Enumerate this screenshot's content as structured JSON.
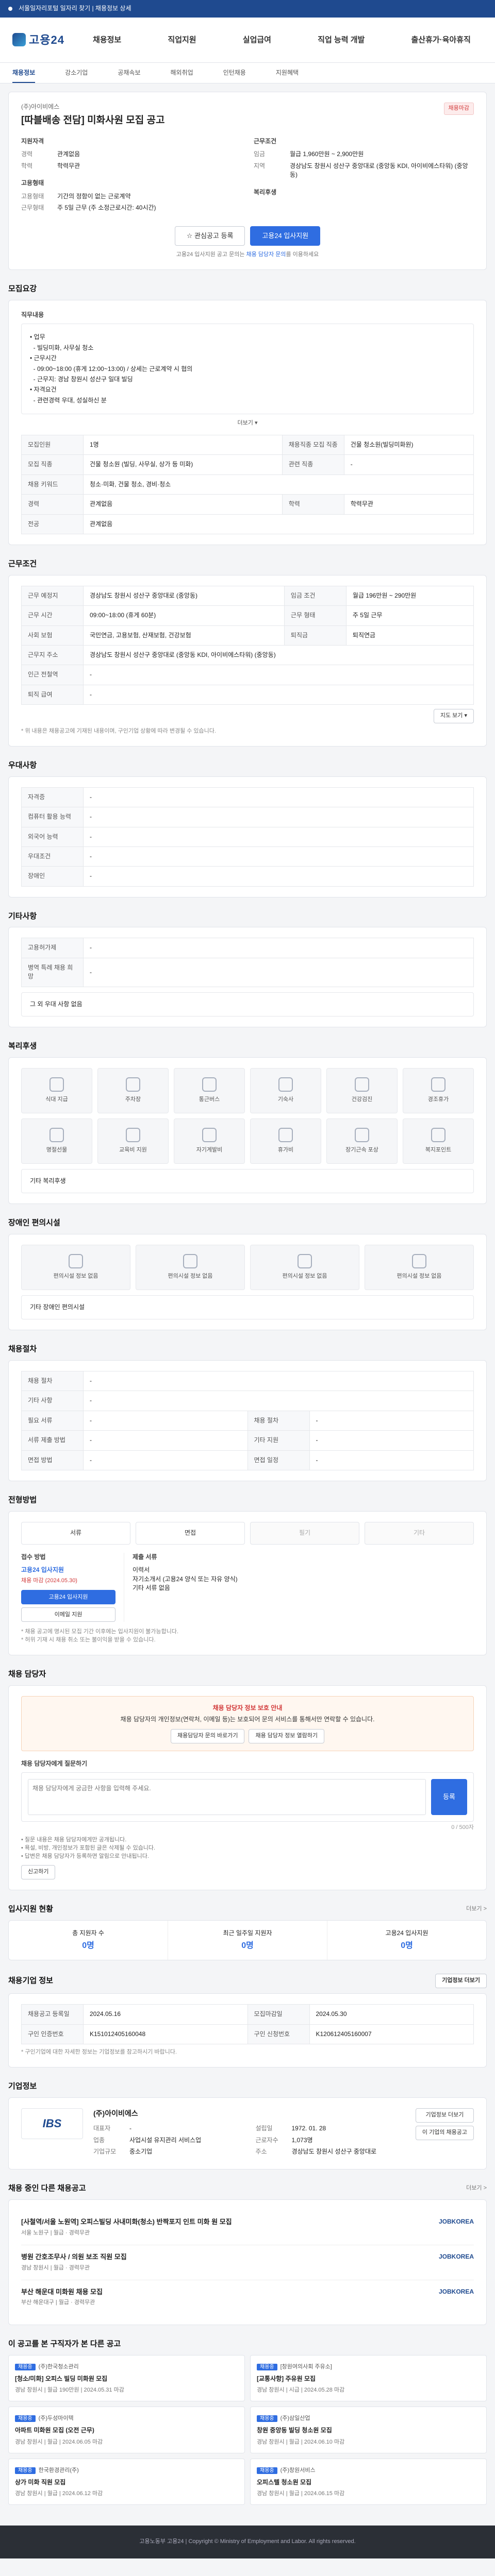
{
  "topbar": {
    "notice": "서울일자리포털 일자리 찾기 | 채용정보 상세"
  },
  "header": {
    "logo": "고용24",
    "nav": [
      "채용정보",
      "직업지원",
      "실업급여",
      "직업 능력 개발",
      "출산휴가·육아휴직"
    ]
  },
  "subnav": [
    "채용정보",
    "강소기업",
    "공채속보",
    "해외취업",
    "인턴채용",
    "지원혜택"
  ],
  "job": {
    "company": "(주)아이비에스",
    "title": "[따블배송 전담] 미화사원 모집 공고",
    "status_badge": "채용마감",
    "left_header": "지원자격",
    "left": [
      {
        "k": "경력",
        "v": "관계없음"
      },
      {
        "k": "학력",
        "v": "학력무관"
      }
    ],
    "left2_header": "고용형태",
    "left2": [
      {
        "k": "고용형태",
        "v": "기간의 정함이 없는 근로계약"
      },
      {
        "k": "근무형태",
        "v": "주 5일 근무 (주 소정근로시간: 40시간)"
      }
    ],
    "right_header": "근무조건",
    "right": [
      {
        "k": "임금",
        "v": "월급 1,960만원 ~ 2,900만원"
      },
      {
        "k": "지역",
        "v": "경상남도 창원시 성산구 중앙대로 (중앙동 KDI, 아이비에스타워) (중앙동)"
      }
    ],
    "right2_header": "복리후생",
    "btn_scrap": "관심공고 등록",
    "btn_apply": "고용24 입사지원",
    "note_pre": "고용24 입사지원 공고 문의는",
    "note_link": "채용 담당자 문의",
    "note_post": "를 이용하세요"
  },
  "recruit": {
    "title": "모집요강",
    "duty_label": "직무내용",
    "duty_lines": [
      "• 업무",
      "  - 빌딩미화, 사무실 청소",
      "• 근무시간",
      "  - 09:00~18:00 (휴게 12:00~13:00) / 상세는 근로계약 시 협의",
      "  - 근무지: 경남 창원시 성산구 일대 빌딩",
      "• 자격요건",
      "  - 관련경력 우대, 성실하신 분"
    ],
    "more": "더보기 ▾",
    "rows": [
      {
        "k1": "모집인원",
        "v1": "1명",
        "k2": "채용직종 모집 직종",
        "v2": "건물 청소원(빌딩미화원)"
      },
      {
        "k1": "모집 직종",
        "v1": "건물 청소원 (빌딩, 사무실, 상가 등 미화)",
        "k2": "관련 직종",
        "v2": "-"
      },
      {
        "k1": "채용 키워드",
        "v1": "청소·미화, 건물 청소, 경비·청소",
        "k2": "",
        "v2": ""
      },
      {
        "k1": "경력",
        "v1": "관계없음",
        "k2": "학력",
        "v2": "학력무관"
      },
      {
        "k1": "전공",
        "v1": "관계없음",
        "k2": "",
        "v2": ""
      }
    ]
  },
  "conditions": {
    "title": "근무조건",
    "rows": [
      {
        "k1": "근무 예정지",
        "v1": "경상남도 창원시 성산구 중앙대로 (중앙동)",
        "k2": "임금 조건",
        "v2": "월급 196만원 ~ 290만원"
      },
      {
        "k1": "근무 시간",
        "v1": "09:00~18:00 (휴게 60분)",
        "k2": "근무 형태",
        "v2": "주 5일 근무"
      },
      {
        "k1": "사회 보험",
        "v1": "국민연금, 고용보험, 산재보험, 건강보험",
        "k2": "퇴직금",
        "v2": "퇴직연금"
      },
      {
        "k1": "근무지 주소",
        "v1": "경상남도 창원시 성산구 중앙대로 (중앙동 KDI, 아이비에스타워) (중앙동)",
        "k2": "",
        "v2": ""
      },
      {
        "k1": "인근 전철역",
        "v1": "-",
        "k2": "",
        "v2": ""
      },
      {
        "k1": "퇴직 급여",
        "v1": "-",
        "k2": "",
        "v2": ""
      }
    ],
    "map_button": "지도 보기 ▾",
    "note": "* 위 내용은 채용공고에 기재된 내용이며, 구인기업 상황에 따라 변경될 수 있습니다."
  },
  "prefs": {
    "title": "우대사항",
    "rows": [
      {
        "k": "자격증",
        "v": "-"
      },
      {
        "k": "컴퓨터 활용 능력",
        "v": "-"
      },
      {
        "k": "외국어 능력",
        "v": "-"
      },
      {
        "k": "우대조건",
        "v": "-"
      },
      {
        "k": "장애인",
        "v": "-"
      }
    ]
  },
  "other": {
    "title": "기타사항",
    "rows": [
      {
        "k": "고용허가제",
        "v": "-"
      },
      {
        "k": "병역 특례 채용 희망",
        "v": "-"
      }
    ],
    "box": "그 외 우대 사항 없음"
  },
  "welfare": {
    "title": "복리후생",
    "items": [
      "식대 지급",
      "주차장",
      "통근버스",
      "기숙사",
      "건강검진",
      "경조휴가",
      "명절선물",
      "교육비 지원",
      "자기계발비",
      "휴가비",
      "장기근속 포상",
      "복지포인트"
    ],
    "extra": "기타 복리후생"
  },
  "disability": {
    "title": "장애인 편의시설",
    "items": [
      "편의시설 정보 없음",
      "편의시설 정보 없음",
      "편의시설 정보 없음",
      "편의시설 정보 없음"
    ],
    "extra": "기타 장애인 편의시설"
  },
  "process": {
    "title": "채용절차",
    "rows": [
      {
        "k1": "채용 절차",
        "v1": "-",
        "k2": "",
        "v2": ""
      },
      {
        "k1": "기타 사항",
        "v1": "-",
        "k2": "",
        "v2": ""
      },
      {
        "k1": "필요 서류",
        "v1": "-",
        "k2": "채용 절차",
        "v2": "-"
      },
      {
        "k1": "서류 제출 방법",
        "v1": "-",
        "k2": "기타 지원",
        "v2": "-"
      },
      {
        "k1": "면접 방법",
        "v1": "-",
        "k2": "면접 일정",
        "v2": "-"
      }
    ]
  },
  "selection": {
    "title": "전형방법",
    "steps": [
      "서류",
      "면접",
      "필기",
      "기타"
    ],
    "apply_left_label": "접수 방법",
    "apply_left_value": "고용24 입사지원",
    "apply_left_sub": "채용 마감 (2024.05.30)",
    "apply_btn": "고용24 입사지원",
    "apply_btn2": "이메일 지원",
    "apply_right_label": "제출 서류",
    "apply_right_lines": [
      "이력서",
      "자기소개서 (고용24 양식 또는 자유 양식)",
      "기타 서류 없음"
    ],
    "note1": "* 채용 공고에 명시된 모집 기간 이후에는 입사지원이 불가능합니다.",
    "note2": "* 허위 기재 시 채용 취소 또는 불이익을 받을 수 있습니다."
  },
  "contact": {
    "title": "채용 담당자",
    "alert_pre": "채용 담당자 정보 보호 안내",
    "alert_body": "채용 담당자의 개인정보(연락처, 이메일 등)는 보호되어 문의 서비스를 통해서만 연락할 수 있습니다.",
    "btn1": "채용담당자 문의 바로가기",
    "btn2": "채용 담당자 정보 열람하기",
    "qa_label": "채용 담당자에게 질문하기",
    "qa_placeholder": "채용 담당자에게 궁금한 사항을 입력해 주세요.",
    "qa_btn": "등록",
    "qa_counter": "0 / 500자",
    "qa_notes": [
      "• 질문 내용은 채용 담당자에게만 공개됩니다.",
      "• 욕설, 비방, 개인정보가 포함된 글은 삭제될 수 있습니다.",
      "• 답변은 채용 담당자가 등록하면 알림으로 안내됩니다."
    ],
    "report_btn": "신고하기"
  },
  "status": {
    "title": "입사지원 현황",
    "more": "더보기 >",
    "items": [
      {
        "label": "총 지원자 수",
        "value": "0명"
      },
      {
        "label": "최근 일주일 지원자",
        "value": "0명"
      },
      {
        "label": "고용24 입사지원",
        "value": "0명"
      }
    ]
  },
  "info": {
    "title": "채용기업 정보",
    "more": "기업정보 더보기",
    "rows": [
      {
        "k1": "채용공고 등록일",
        "v1": "2024.05.16",
        "k2": "모집마감일",
        "v2": "2024.05.30"
      },
      {
        "k1": "구인 인증번호",
        "v1": "K151012405160048",
        "k2": "구인 신청번호",
        "v2": "K120612405160007"
      }
    ],
    "note": "* 구인기업에 대한 자세한 정보는 기업정보를 참고하시기 바랍니다."
  },
  "company": {
    "title": "기업정보",
    "logo_text": "IBS",
    "name": "(주)아이비에스",
    "ceo_k": "대표자",
    "ceo_v": "-",
    "biz_k": "업종",
    "biz_v": "사업시설 유지관리 서비스업",
    "size_k": "기업규모",
    "size_v": "중소기업",
    "addr_k": "주소",
    "addr_v": "경상남도 창원시 성산구 중앙대로",
    "emp_k": "근로자수",
    "emp_v": "1,073명",
    "found_k": "설립일",
    "found_v": "1972. 01. 28",
    "btn_company": "기업정보 더보기",
    "btn_all": "이 기업의 채용공고"
  },
  "related": {
    "title": "채용 중인 다른 채용공고",
    "more": "더보기 >",
    "items": [
      {
        "t": "[사철역/서울 노원역] 오피스빌딩 사내미화(청소) 반짝포지 인트 미화 원 모집",
        "s": "서울 노원구 | 월급 · 경력무관",
        "co": "JOBKOREA"
      },
      {
        "t": "병원 간호조무사 / 의원 보조 직원 모집",
        "s": "경남 창원시 | 월급 · 경력무관",
        "co": "JOBKOREA"
      },
      {
        "t": "부산 해운대 미화원 채용 모집",
        "s": "부산 해운대구 | 월급 · 경력무관",
        "co": "JOBKOREA"
      }
    ]
  },
  "viewed": {
    "title": "이 공고를 본 구직자가 본 다른 공고",
    "items": [
      {
        "tag": "채용중",
        "co": "(주)한국청소관리",
        "t": "[청소/미화] 오피스 빌딩 미화원 모집",
        "s": "경남 창원시 | 월급 190만원 | 2024.05.31 마감"
      },
      {
        "tag": "채용중",
        "co": "[창원여의사회 주유소]",
        "t": "[교통사항] 주유원 모집",
        "s": "경남 창원시 | 시급 | 2024.05.28 마감"
      },
      {
        "tag": "채용중",
        "co": "(주)두성마이텍",
        "t": "아파트 미화원 모집 (오전 근무)",
        "s": "경남 창원시 | 월급 | 2024.06.05 마감"
      },
      {
        "tag": "채용중",
        "co": "(주)삼일산업",
        "t": "창원 중앙동 빌딩 청소원 모집",
        "s": "경남 창원시 | 월급 | 2024.06.10 마감"
      },
      {
        "tag": "채용중",
        "co": "한국환경관리(주)",
        "t": "상가 미화 직원 모집",
        "s": "경남 창원시 | 월급 | 2024.06.12 마감"
      },
      {
        "tag": "채용중",
        "co": "(주)창원서비스",
        "t": "오피스텔 청소원 모집",
        "s": "경남 창원시 | 월급 | 2024.06.15 마감"
      }
    ]
  },
  "footer": {
    "text": "고용노동부 고용24 | Copyright © Ministry of Employment and Labor. All rights reserved."
  }
}
